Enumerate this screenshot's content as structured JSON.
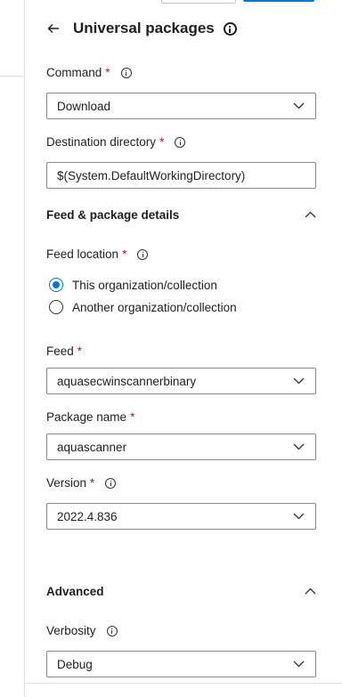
{
  "header": {
    "title": "Universal packages"
  },
  "command": {
    "label": "Command",
    "value": "Download"
  },
  "destination": {
    "label": "Destination directory",
    "value": "$(System.DefaultWorkingDirectory)"
  },
  "feed_section": {
    "title": "Feed & package details"
  },
  "feed_location": {
    "label": "Feed location",
    "options": [
      "This organization/collection",
      "Another organization/collection"
    ],
    "selected": "This organization/collection"
  },
  "feed": {
    "label": "Feed",
    "value": "aquasecwinscannerbinary"
  },
  "package": {
    "label": "Package name",
    "value": "aquascanner"
  },
  "version": {
    "label": "Version",
    "value": "2022.4.836"
  },
  "advanced_section": {
    "title": "Advanced"
  },
  "verbosity": {
    "label": "Verbosity",
    "value": "Debug"
  },
  "required_marker": "*",
  "colors": {
    "accent": "#0078d4",
    "required": "#a4262c",
    "border": "#8a8886"
  }
}
